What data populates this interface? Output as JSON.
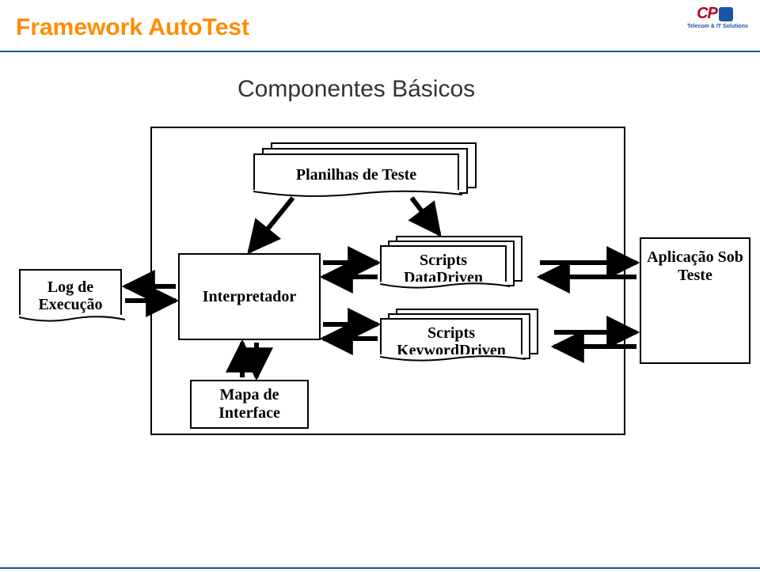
{
  "header": {
    "title": "Framework AutoTest",
    "subtitle": "Componentes Básicos",
    "logo_text": "CP",
    "logo_subtitle": "Telecom & IT Solutions"
  },
  "components": {
    "planilhas": "Planilhas de Teste",
    "log": "Log de\nExecução",
    "interpretador": "Interpretador",
    "scripts_data": "Scripts\nDataDriven",
    "scripts_keyword": "Scripts\nKeywordDriven",
    "aplicacao": "Aplicação Sob\nTeste",
    "mapa": "Mapa de\nInterface"
  }
}
